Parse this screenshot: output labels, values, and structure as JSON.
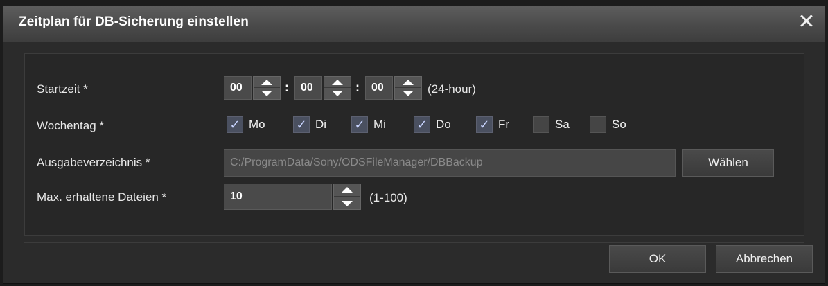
{
  "dialog": {
    "title": "Zeitplan für DB-Sicherung einstellen",
    "close_symbol": "✕"
  },
  "start_time": {
    "label": "Startzeit *",
    "hours": "00",
    "minutes": "00",
    "seconds": "00",
    "separator": ":",
    "hint": "(24-hour)"
  },
  "weekday": {
    "label": "Wochentag *",
    "days": [
      {
        "label": "Mo",
        "checked": true
      },
      {
        "label": "Di",
        "checked": true
      },
      {
        "label": "Mi",
        "checked": true
      },
      {
        "label": "Do",
        "checked": true
      },
      {
        "label": "Fr",
        "checked": true
      },
      {
        "label": "Sa",
        "checked": false
      },
      {
        "label": "So",
        "checked": false
      }
    ],
    "check_symbol": "✓"
  },
  "output_dir": {
    "label": "Ausgabeverzeichnis *",
    "value": "C:/ProgramData/Sony/ODSFileManager/DBBackup",
    "browse_label": "Wählen"
  },
  "max_files": {
    "label": "Max. erhaltene Dateien *",
    "value": "10",
    "hint": "(1-100)"
  },
  "footer": {
    "ok_label": "OK",
    "cancel_label": "Abbrechen"
  },
  "icons": {
    "close": "close-icon",
    "spin_up": "arrow-up-icon",
    "spin_down": "arrow-down-icon",
    "check": "checkmark-icon"
  },
  "colors": {
    "title_bar": "#4a4a4a",
    "background": "#2b2b2b",
    "check_accent": "#c8d4ff"
  }
}
